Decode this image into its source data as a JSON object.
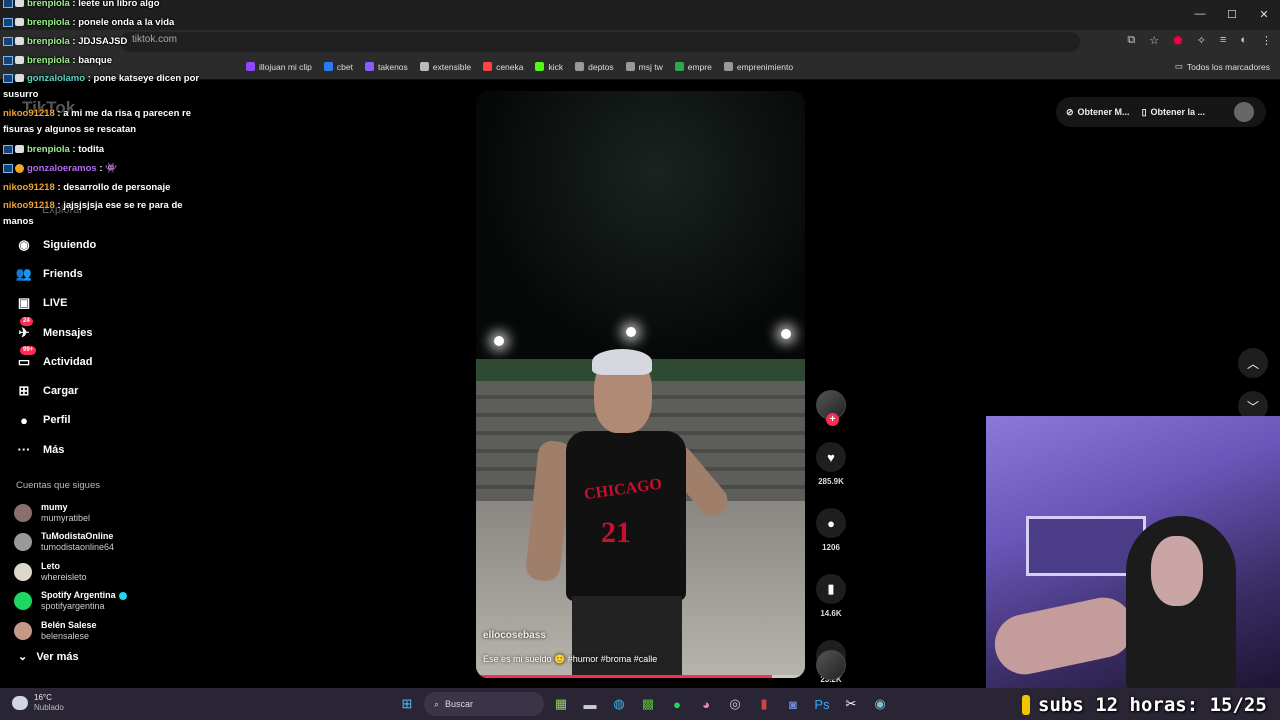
{
  "browser": {
    "url_text": "tiktok.com",
    "window_controls": [
      "—",
      "☐",
      "✕"
    ],
    "bookmarks": [
      {
        "label": "illojuan mi clip",
        "color": "#9146ff"
      },
      {
        "label": "cbet",
        "color": "#2b7bff"
      },
      {
        "label": "takenos",
        "color": "#8a5cff"
      },
      {
        "label": "extensible",
        "color": "#bbbbbb"
      },
      {
        "label": "ceneka",
        "color": "#ff4444"
      },
      {
        "label": "kick",
        "color": "#53fc18"
      },
      {
        "label": "deptos",
        "color": "#999999"
      },
      {
        "label": "msj tw",
        "color": "#999999"
      },
      {
        "label": "empre",
        "color": "#2ea84d"
      },
      {
        "label": "emprenimiento",
        "color": "#999999"
      }
    ],
    "bookmarks_right": "Todos los marcadores"
  },
  "sidebar": {
    "logo": "TikTok",
    "explore": "Explorar",
    "nav": [
      {
        "label": "Siguiendo",
        "icon": "following-avatar-icon",
        "glyph": "◉",
        "badge": ""
      },
      {
        "label": "Friends",
        "icon": "friends-icon",
        "glyph": "👥",
        "badge": ""
      },
      {
        "label": "LIVE",
        "icon": "live-icon",
        "glyph": "▣",
        "badge": ""
      },
      {
        "label": "Mensajes",
        "icon": "messages-icon",
        "glyph": "✈",
        "badge": "24"
      },
      {
        "label": "Actividad",
        "icon": "activity-icon",
        "glyph": "▭",
        "badge": "99+"
      },
      {
        "label": "Cargar",
        "icon": "upload-icon",
        "glyph": "⊞",
        "badge": ""
      },
      {
        "label": "Perfil",
        "icon": "profile-icon",
        "glyph": "●",
        "badge": ""
      },
      {
        "label": "Más",
        "icon": "more-icon",
        "glyph": "···",
        "badge": ""
      }
    ],
    "following_title": "Cuentas que sigues",
    "following": [
      {
        "name": "mumy",
        "user": "mumyratibel",
        "verified": false,
        "color": "#8a6f6a"
      },
      {
        "name": "TuModistaOnline",
        "user": "tumodistaonline64",
        "verified": false,
        "color": "#999999"
      },
      {
        "name": "Leto",
        "user": "whereisleto",
        "verified": false,
        "color": "#ddd7cc"
      },
      {
        "name": "Spotify Argentina",
        "user": "spotifyargentina",
        "verified": true,
        "color": "#1ed760"
      },
      {
        "name": "Belén Salese",
        "user": "belensalese",
        "verified": false,
        "color": "#c49a87"
      }
    ],
    "see_more": "Ver más"
  },
  "chat": [
    {
      "icons": "tw",
      "user": "brenpiola",
      "color": "#9af28c",
      "msg": "leete un libro algo",
      "wrap": false
    },
    {
      "icons": "tw",
      "user": "brenpiola",
      "color": "#9af28c",
      "msg": "ponele onda a la vida",
      "wrap": false
    },
    {
      "icons": "tw",
      "user": "brenpiola",
      "color": "#9af28c",
      "msg": "JDJSAJSD",
      "wrap": false
    },
    {
      "icons": "tw",
      "user": "brenpiola",
      "color": "#9af28c",
      "msg": "banque",
      "wrap": false
    },
    {
      "icons": "tw",
      "user": "gonzalolamo",
      "color": "#59d6c6",
      "msg": "pone katseye dicen por susurro",
      "wrap": true
    },
    {
      "icons": "",
      "user": "nikoo91218",
      "color": "#f0a23a",
      "msg": "a mi me da risa q parecen re fisuras y algunos se rescatan",
      "wrap": true
    },
    {
      "icons": "tw",
      "user": "brenpiola",
      "color": "#9af28c",
      "msg": "todita",
      "wrap": false
    },
    {
      "icons": "sub",
      "user": "gonzaloeramos",
      "color": "#b46cf0",
      "msg": "👾",
      "wrap": false
    },
    {
      "icons": "",
      "user": "nikoo91218",
      "color": "#f0a23a",
      "msg": "desarrollo de personaje",
      "wrap": false
    },
    {
      "icons": "",
      "user": "nikoo91218",
      "color": "#f0a23a",
      "msg": "jajsjsjsja ese se re para de manos",
      "wrap": true
    }
  ],
  "video": {
    "author": "ellocosebass",
    "caption": "Ese es mi sueldo 🙂 #humor #broma #calle",
    "progress": 0.9,
    "jersey_text": "CHICAGO",
    "jersey_number": "21"
  },
  "actions": {
    "likes": "285.9K",
    "comments": "1206",
    "saves": "14.6K",
    "shares": "23.2K"
  },
  "topright": {
    "btn1": "Obtener M...",
    "btn2": "Obtener la ..."
  },
  "subs": {
    "text": "subs 12 horas: 15/25"
  },
  "taskbar": {
    "temp": "16°C",
    "weather": "Nublado",
    "search": "Buscar"
  }
}
